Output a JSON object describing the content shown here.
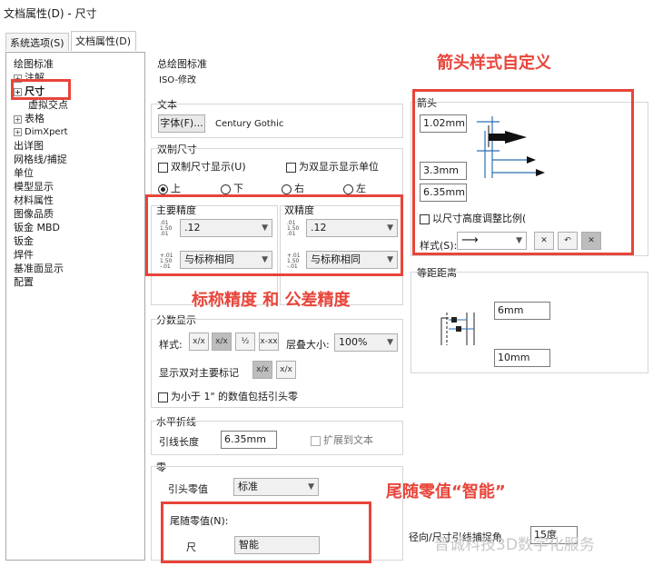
{
  "window": {
    "title": "文档属性(D) - 尺寸"
  },
  "tabs": [
    {
      "label": "系统选项(S)",
      "active": false
    },
    {
      "label": "文档属性(D)",
      "active": true
    }
  ],
  "tree": {
    "items": [
      {
        "label": "绘图标准"
      },
      {
        "label": "注解",
        "expandable": true
      },
      {
        "label": "尺寸",
        "expandable": true,
        "selected": true
      },
      {
        "label": "虚拟交点"
      },
      {
        "label": "表格",
        "expandable": true
      },
      {
        "label": "DimXpert",
        "expandable": true
      },
      {
        "label": "出详图"
      },
      {
        "label": "网格线/捕捉"
      },
      {
        "label": "单位"
      },
      {
        "label": "模型显示"
      },
      {
        "label": "材料属性"
      },
      {
        "label": "图像品质"
      },
      {
        "label": "钣金 MBD"
      },
      {
        "label": "钣金"
      },
      {
        "label": "焊件"
      },
      {
        "label": "基准面显示"
      },
      {
        "label": "配置"
      }
    ]
  },
  "standard": {
    "heading": "总绘图标准",
    "value": "ISO-修改"
  },
  "text": {
    "heading": "文本",
    "font_button": "字体(F)...",
    "font_name": "Century Gothic"
  },
  "dual": {
    "heading": "双制尺寸",
    "show_dual": "双制尺寸显示(U)",
    "show_units": "为双显示显示单位",
    "positions": [
      "上",
      "下",
      "右",
      "左"
    ],
    "selected_position": "上"
  },
  "precision": {
    "primary_heading": "主要精度",
    "primary_value": ".12",
    "primary_tol": "与标称相同",
    "dual_heading": "双精度",
    "dual_value": ".12",
    "dual_tol": "与标称相同"
  },
  "fraction": {
    "heading": "分数显示",
    "style_label": "样式:",
    "stack_label": "层叠大小:",
    "stack_value": "100%",
    "dual_primary_label": "显示双对主要标记",
    "leading_zero_label": "为小于 1\" 的数值包括引头零"
  },
  "break_line": {
    "heading": "水平折线",
    "leader_label": "引线长度",
    "leader_value": "6.35mm",
    "extend_label": "扩展到文本"
  },
  "zero": {
    "heading": "零",
    "leading_label": "引头零值",
    "leading_value": "标准",
    "trailing_label": "尾随零值(N):",
    "dim_label": "尺",
    "dim_value": "智能"
  },
  "snap": {
    "label": "径向/尺寸引线捕捉角",
    "value": "15度"
  },
  "arrows": {
    "heading": "箭头",
    "size1": "1.02mm",
    "size2": "3.3mm",
    "size3": "6.35mm",
    "scale_label": "以尺寸高度调整比例(",
    "style_label": "样式(S):"
  },
  "offset": {
    "heading": "等距距离",
    "value1": "6mm",
    "value2": "10mm"
  },
  "annotations": {
    "arrow_style": "箭头样式自定义",
    "precision": "标称精度 和 公差精度",
    "trailing": "尾随零值“智能”"
  },
  "watermark": "晋诚科技3D数字化服务"
}
